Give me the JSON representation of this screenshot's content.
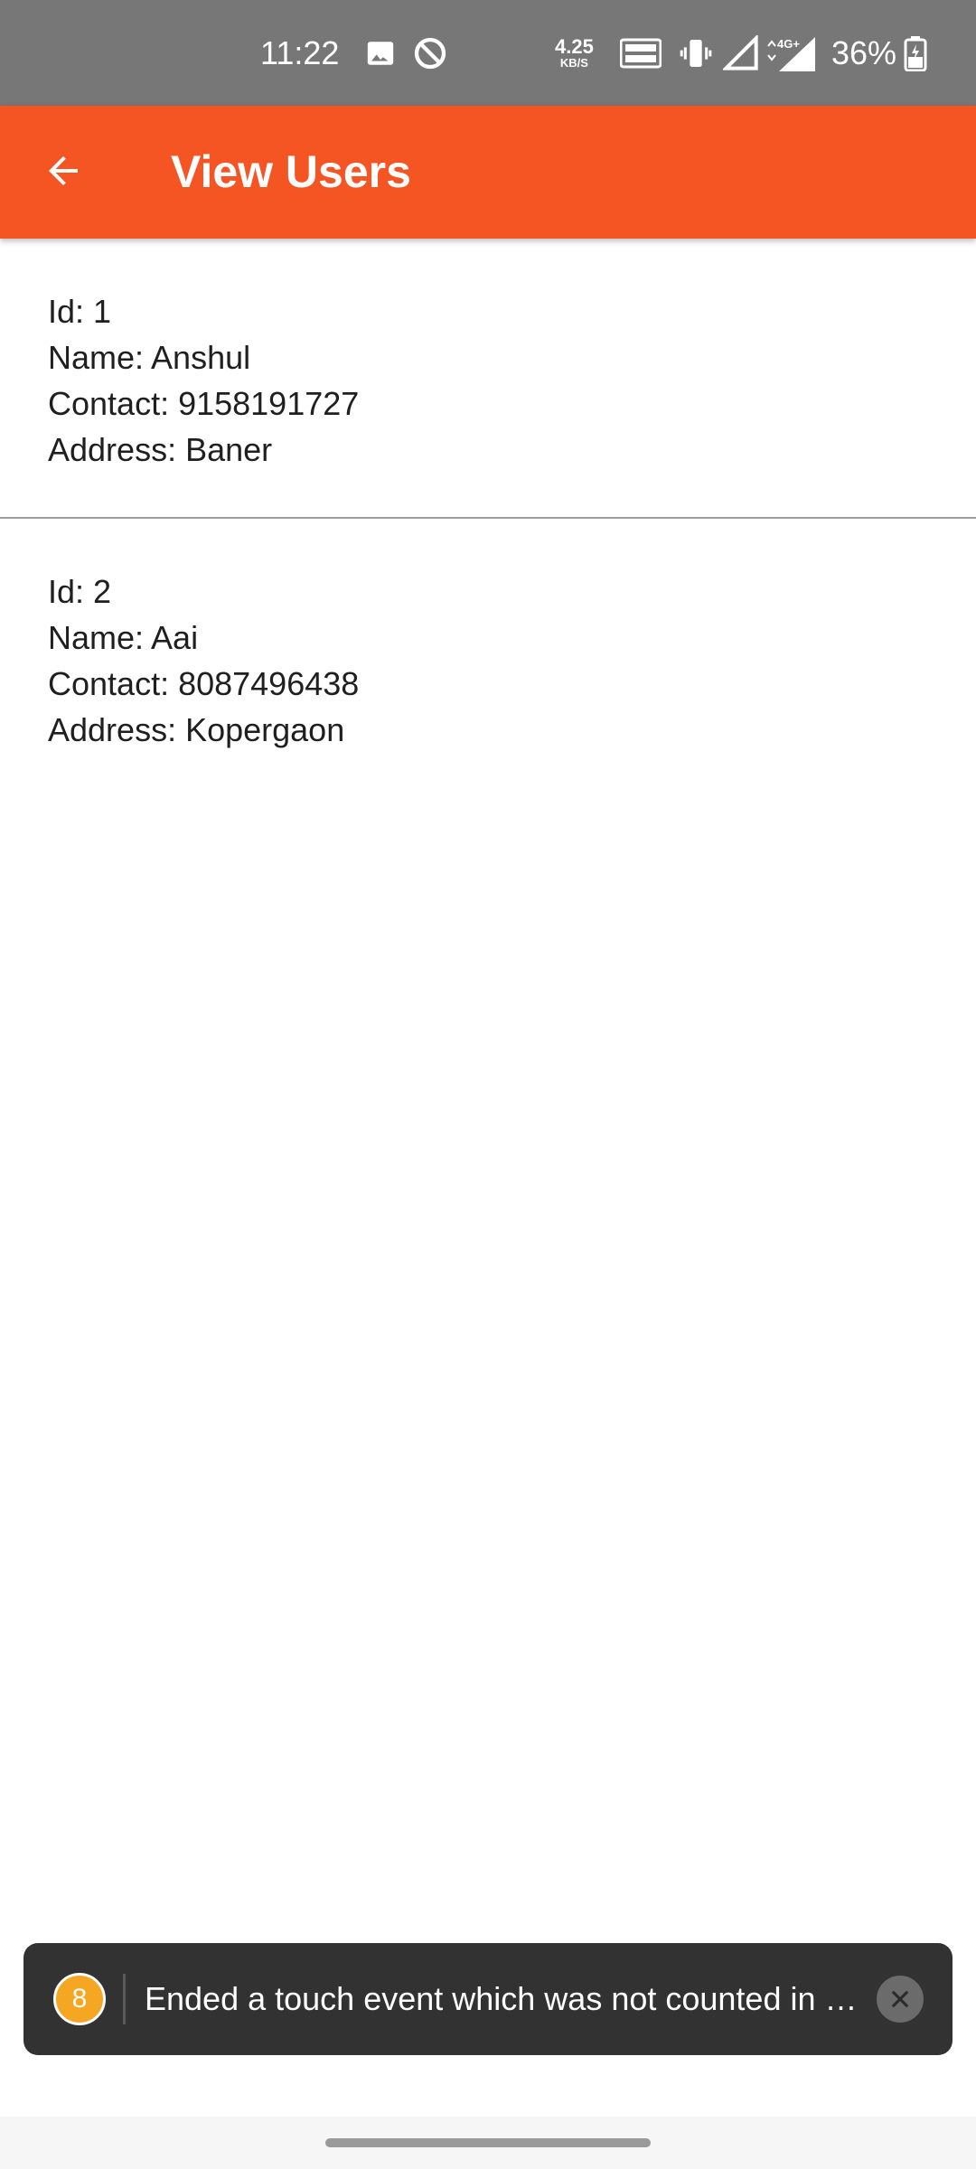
{
  "status_bar": {
    "time": "11:22",
    "net_speed_value": "4.25",
    "net_speed_unit": "KB/S",
    "battery_percent": "36%",
    "icons": [
      "image-icon",
      "do-not-disturb-icon",
      "volte-icon",
      "vibrate-icon",
      "signal-icon",
      "signal-4g-icon",
      "battery-charging-icon"
    ]
  },
  "app_bar": {
    "title": "View Users",
    "back_icon": "arrow-back-icon",
    "color": "#F55522"
  },
  "users": [
    {
      "id": "Id: 1",
      "name": "Name: Anshul",
      "contact": "Contact: 9158191727",
      "address": "Address: Baner"
    },
    {
      "id": "Id: 2",
      "name": "Name: Aai",
      "contact": "Contact: 8087496438",
      "address": "Address: Kopergaon"
    }
  ],
  "toast": {
    "badge": "8",
    "message": "Ended a touch event which was not counted in …",
    "close_icon": "close-icon"
  }
}
